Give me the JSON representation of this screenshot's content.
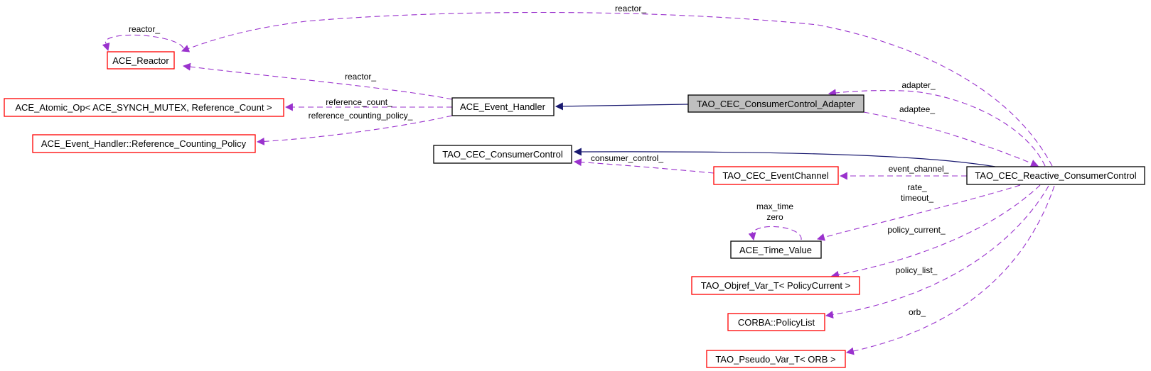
{
  "diagram": {
    "type": "collaboration-graph",
    "colors": {
      "usage_edge": "#9a32cd",
      "inheritance_edge": "#191970",
      "focus_fill": "#bfbfbf",
      "documented_border": "#000000",
      "undocumented_border": "#ff0000"
    },
    "nodes": [
      {
        "id": "ace_reactor",
        "label": "ACE_Reactor",
        "style": "red"
      },
      {
        "id": "ace_atomic_op",
        "label": "ACE_Atomic_Op< ACE_SYNCH_MUTEX, Reference_Count >",
        "style": "red"
      },
      {
        "id": "ace_ref_counting_policy",
        "label": "ACE_Event_Handler::Reference_Counting_Policy",
        "style": "red"
      },
      {
        "id": "ace_event_handler",
        "label": "ACE_Event_Handler",
        "style": "black"
      },
      {
        "id": "tao_cec_consumercontrol",
        "label": "TAO_CEC_ConsumerControl",
        "style": "black"
      },
      {
        "id": "tao_cec_consumercontrol_adapter",
        "label": "TAO_CEC_ConsumerControl_Adapter",
        "style": "focus"
      },
      {
        "id": "tao_cec_eventchannel",
        "label": "TAO_CEC_EventChannel",
        "style": "red"
      },
      {
        "id": "tao_cec_reactive_consumercontrol",
        "label": "TAO_CEC_Reactive_ConsumerControl",
        "style": "black"
      },
      {
        "id": "ace_time_value",
        "label": "ACE_Time_Value",
        "style": "black"
      },
      {
        "id": "tao_objref_var_t",
        "label": "TAO_Objref_Var_T< PolicyCurrent >",
        "style": "red"
      },
      {
        "id": "corba_policylist",
        "label": "CORBA::PolicyList",
        "style": "red"
      },
      {
        "id": "tao_pseudo_var_t",
        "label": "TAO_Pseudo_Var_T< ORB >",
        "style": "red"
      }
    ],
    "edges": [
      {
        "from": "ace_reactor",
        "to": "ace_reactor",
        "label": "reactor_",
        "kind": "usage"
      },
      {
        "from": "tao_cec_reactive_consumercontrol",
        "to": "ace_reactor",
        "label": "reactor_",
        "kind": "usage"
      },
      {
        "from": "ace_event_handler",
        "to": "ace_reactor",
        "label": "reactor_",
        "kind": "usage"
      },
      {
        "from": "ace_event_handler",
        "to": "ace_atomic_op",
        "label": "reference_count_",
        "kind": "usage"
      },
      {
        "from": "ace_event_handler",
        "to": "ace_ref_counting_policy",
        "label": "reference_counting_policy_",
        "kind": "usage"
      },
      {
        "from": "tao_cec_consumercontrol_adapter",
        "to": "ace_event_handler",
        "label": "",
        "kind": "inheritance"
      },
      {
        "from": "tao_cec_reactive_consumercontrol",
        "to": "tao_cec_consumercontrol_adapter",
        "label": "adapter_",
        "kind": "usage"
      },
      {
        "from": "tao_cec_consumercontrol_adapter",
        "to": "tao_cec_reactive_consumercontrol",
        "label": "adaptee_",
        "kind": "usage"
      },
      {
        "from": "tao_cec_reactive_consumercontrol",
        "to": "tao_cec_consumercontrol",
        "label": "",
        "kind": "inheritance"
      },
      {
        "from": "tao_cec_eventchannel",
        "to": "tao_cec_consumercontrol",
        "label": "consumer_control_",
        "kind": "usage"
      },
      {
        "from": "tao_cec_reactive_consumercontrol",
        "to": "tao_cec_eventchannel",
        "label": "event_channel_",
        "kind": "usage"
      },
      {
        "from": "ace_time_value",
        "to": "ace_time_value",
        "label": "max_time\nzero",
        "kind": "usage"
      },
      {
        "from": "tao_cec_reactive_consumercontrol",
        "to": "ace_time_value",
        "label": "rate_\ntimeout_",
        "kind": "usage"
      },
      {
        "from": "tao_cec_reactive_consumercontrol",
        "to": "tao_objref_var_t",
        "label": "policy_current_",
        "kind": "usage"
      },
      {
        "from": "tao_cec_reactive_consumercontrol",
        "to": "corba_policylist",
        "label": "policy_list_",
        "kind": "usage"
      },
      {
        "from": "tao_cec_reactive_consumercontrol",
        "to": "tao_pseudo_var_t",
        "label": "orb_",
        "kind": "usage"
      }
    ],
    "edge_labels": {
      "reactor_self": "reactor_",
      "reactor_top": "reactor_",
      "reactor_eh": "reactor_",
      "reference_count": "reference_count_",
      "reference_counting_policy": "reference_counting_policy_",
      "adapter": "adapter_",
      "adaptee": "adaptee_",
      "consumer_control": "consumer_control_",
      "event_channel": "event_channel_",
      "max_time": "max_time",
      "zero": "zero",
      "rate": "rate_",
      "timeout": "timeout_",
      "policy_current": "policy_current_",
      "policy_list": "policy_list_",
      "orb": "orb_"
    }
  }
}
